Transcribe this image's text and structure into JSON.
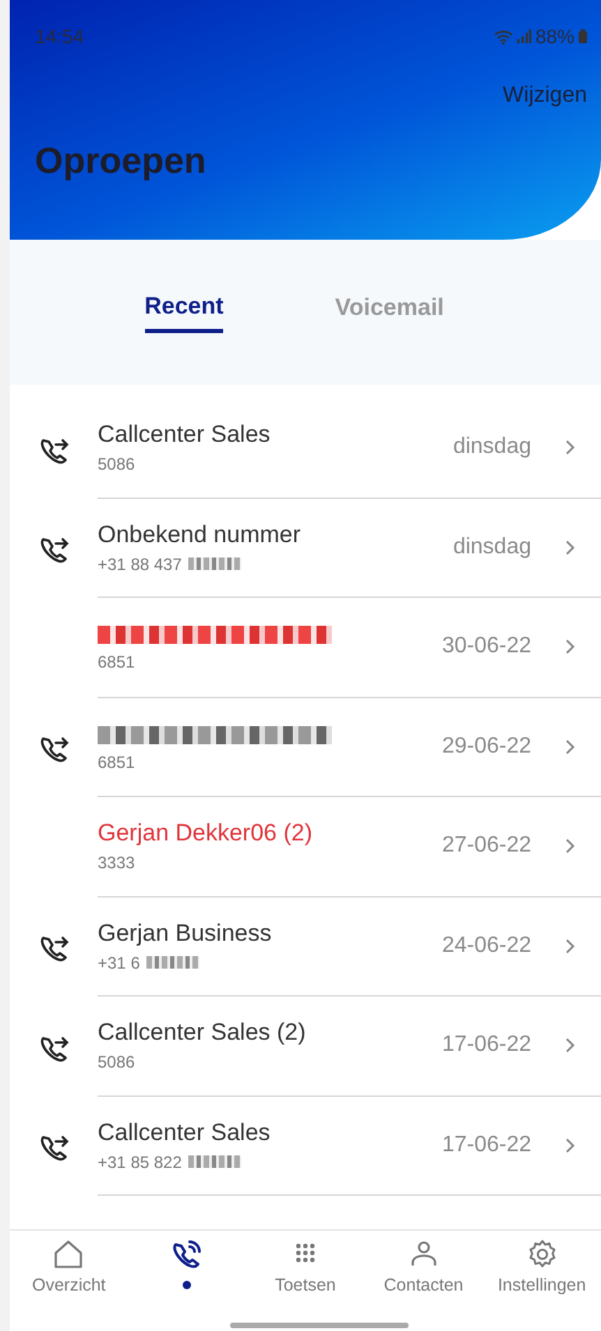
{
  "status_bar": {
    "time": "14:54",
    "battery": "88%"
  },
  "header": {
    "action": "Wijzigen",
    "title": "Oproepen"
  },
  "tabs": [
    {
      "label": "Recent",
      "selected": true
    },
    {
      "label": "Voicemail",
      "selected": false
    }
  ],
  "calls": [
    {
      "kind": "outgoing",
      "name": "Callcenter Sales",
      "number": "5086",
      "date": "dinsdag"
    },
    {
      "kind": "outgoing",
      "name": "Onbekend nummer",
      "number": "+31 88 437",
      "redacted_number": true,
      "date": "dinsdag"
    },
    {
      "kind": "missed",
      "number": "6851",
      "redacted_name": true,
      "date": "30-06-22"
    },
    {
      "kind": "outgoing",
      "number": "6851",
      "redacted_name": true,
      "date": "29-06-22"
    },
    {
      "kind": "missed",
      "name": "Gerjan Dekker06 (2)",
      "number": "3333",
      "date": "27-06-22"
    },
    {
      "kind": "outgoing",
      "name": "Gerjan Business",
      "number": "+31 6",
      "redacted_number": true,
      "date": "24-06-22"
    },
    {
      "kind": "outgoing",
      "name": "Callcenter Sales (2)",
      "number": "5086",
      "date": "17-06-22"
    },
    {
      "kind": "outgoing",
      "name": "Callcenter Sales",
      "number": "+31 85 822",
      "redacted_number": true,
      "date": "17-06-22"
    }
  ],
  "nav": [
    {
      "kind": "home",
      "label": "Overzicht",
      "selected": false
    },
    {
      "kind": "calls",
      "selected": true
    },
    {
      "kind": "keypad",
      "label": "Toetsen",
      "selected": false
    },
    {
      "kind": "contacts",
      "label": "Contacten",
      "selected": false
    },
    {
      "kind": "settings",
      "label": "Instellingen",
      "selected": false
    }
  ]
}
